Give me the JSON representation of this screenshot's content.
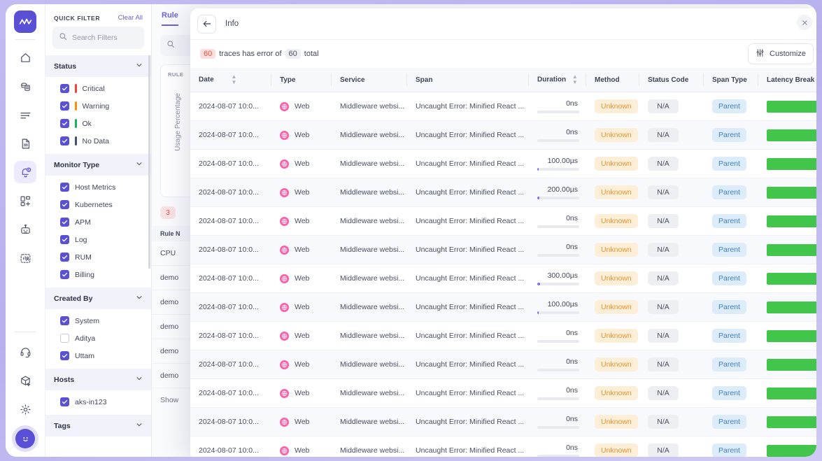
{
  "rail": {
    "logo_name": "middleware-logo",
    "items": [
      {
        "name": "home-icon"
      },
      {
        "name": "infrastructure-icon"
      },
      {
        "name": "logs-icon"
      },
      {
        "name": "documents-icon"
      },
      {
        "name": "alerts-icon",
        "active": true
      },
      {
        "name": "dashboards-add-icon"
      },
      {
        "name": "robot-icon"
      },
      {
        "name": "user-analytics-icon"
      }
    ],
    "bottom_items": [
      {
        "name": "support-headset-icon"
      },
      {
        "name": "package-add-icon"
      },
      {
        "name": "settings-gear-icon"
      }
    ],
    "avatar_name": "user-avatar"
  },
  "quick_filter": {
    "title": "QUICK FILTER",
    "clear_all": "Clear All",
    "search_placeholder": "Search Filters",
    "search_value": "",
    "groups": [
      {
        "label": "Status",
        "items": [
          {
            "label": "Critical",
            "checked": true,
            "color": "#f04438"
          },
          {
            "label": "Warning",
            "checked": true,
            "color": "#f79009"
          },
          {
            "label": "Ok",
            "checked": true,
            "color": "#17b26a"
          },
          {
            "label": "No Data",
            "checked": true,
            "color": "#475467"
          }
        ]
      },
      {
        "label": "Monitor Type",
        "items": [
          {
            "label": "Host Metrics",
            "checked": true
          },
          {
            "label": "Kubernetes",
            "checked": true
          },
          {
            "label": "APM",
            "checked": true
          },
          {
            "label": "Log",
            "checked": true
          },
          {
            "label": "RUM",
            "checked": true
          },
          {
            "label": "Billing",
            "checked": true
          }
        ]
      },
      {
        "label": "Created By",
        "items": [
          {
            "label": "System",
            "checked": true
          },
          {
            "label": "Aditya",
            "checked": false
          },
          {
            "label": "Uttam",
            "checked": true
          }
        ]
      },
      {
        "label": "Hosts",
        "items": [
          {
            "label": "aks-in123",
            "checked": true
          }
        ]
      },
      {
        "label": "Tags",
        "items": []
      }
    ]
  },
  "background": {
    "tab_label": "Rule",
    "card_label": "RULE",
    "vertical_axis_label": "Usage Percentage",
    "badge": "3",
    "table_header": "Rule N",
    "rows": [
      "CPU",
      "demo",
      "demo",
      "demo",
      "demo",
      "demo"
    ],
    "show_more": "Show"
  },
  "modal": {
    "title": "Info",
    "back_icon": "arrow-left-icon",
    "close_icon": "close-icon",
    "summary": {
      "error_count": "60",
      "text_middle": "traces has error of",
      "total_count": "60",
      "text_end": "total"
    },
    "customize_label": "Customize",
    "customize_icon": "sliders-icon",
    "table": {
      "columns": [
        {
          "key": "date",
          "label": "Date",
          "sortable": true
        },
        {
          "key": "type",
          "label": "Type",
          "sortable": false
        },
        {
          "key": "service",
          "label": "Service",
          "sortable": false
        },
        {
          "key": "span",
          "label": "Span",
          "sortable": false
        },
        {
          "key": "duration",
          "label": "Duration",
          "sortable": true
        },
        {
          "key": "method",
          "label": "Method",
          "sortable": false
        },
        {
          "key": "status_code",
          "label": "Status Code",
          "sortable": false
        },
        {
          "key": "span_type",
          "label": "Span Type",
          "sortable": false
        },
        {
          "key": "latency",
          "label": "Latency Break",
          "sortable": false
        }
      ],
      "rows": [
        {
          "date": "2024-08-07 10:0...",
          "type": "Web",
          "service": "Middleware websi...",
          "span": "Uncaught Error: Minified React ...",
          "duration": "0ns",
          "duration_pct": 0,
          "method": "Unknown",
          "status_code": "N/A",
          "span_type": "Parent",
          "latency_pct": 100
        },
        {
          "date": "2024-08-07 10:0...",
          "type": "Web",
          "service": "Middleware websi...",
          "span": "Uncaught Error: Minified React ...",
          "duration": "0ns",
          "duration_pct": 0,
          "method": "Unknown",
          "status_code": "N/A",
          "span_type": "Parent",
          "latency_pct": 100
        },
        {
          "date": "2024-08-07 10:0...",
          "type": "Web",
          "service": "Middleware websi...",
          "span": "Uncaught Error: Minified React ...",
          "duration": "100.00µs",
          "duration_pct": 4,
          "method": "Unknown",
          "status_code": "N/A",
          "span_type": "Parent",
          "latency_pct": 100
        },
        {
          "date": "2024-08-07 10:0...",
          "type": "Web",
          "service": "Middleware websi...",
          "span": "Uncaught Error: Minified React ...",
          "duration": "200.00µs",
          "duration_pct": 5,
          "method": "Unknown",
          "status_code": "N/A",
          "span_type": "Parent",
          "latency_pct": 100
        },
        {
          "date": "2024-08-07 10:0...",
          "type": "Web",
          "service": "Middleware websi...",
          "span": "Uncaught Error: Minified React ...",
          "duration": "0ns",
          "duration_pct": 0,
          "method": "Unknown",
          "status_code": "N/A",
          "span_type": "Parent",
          "latency_pct": 100
        },
        {
          "date": "2024-08-07 10:0...",
          "type": "Web",
          "service": "Middleware websi...",
          "span": "Uncaught Error: Minified React ...",
          "duration": "0ns",
          "duration_pct": 0,
          "method": "Unknown",
          "status_code": "N/A",
          "span_type": "Parent",
          "latency_pct": 100
        },
        {
          "date": "2024-08-07 10:0...",
          "type": "Web",
          "service": "Middleware websi...",
          "span": "Uncaught Error: Minified React ...",
          "duration": "300.00µs",
          "duration_pct": 6,
          "method": "Unknown",
          "status_code": "N/A",
          "span_type": "Parent",
          "latency_pct": 100
        },
        {
          "date": "2024-08-07 10:0...",
          "type": "Web",
          "service": "Middleware websi...",
          "span": "Uncaught Error: Minified React ...",
          "duration": "100.00µs",
          "duration_pct": 4,
          "method": "Unknown",
          "status_code": "N/A",
          "span_type": "Parent",
          "latency_pct": 100
        },
        {
          "date": "2024-08-07 10:0...",
          "type": "Web",
          "service": "Middleware websi...",
          "span": "Uncaught Error: Minified React ...",
          "duration": "0ns",
          "duration_pct": 0,
          "method": "Unknown",
          "status_code": "N/A",
          "span_type": "Parent",
          "latency_pct": 100
        },
        {
          "date": "2024-08-07 10:0...",
          "type": "Web",
          "service": "Middleware websi...",
          "span": "Uncaught Error: Minified React ...",
          "duration": "0ns",
          "duration_pct": 0,
          "method": "Unknown",
          "status_code": "N/A",
          "span_type": "Parent",
          "latency_pct": 100
        },
        {
          "date": "2024-08-07 10:0...",
          "type": "Web",
          "service": "Middleware websi...",
          "span": "Uncaught Error: Minified React ...",
          "duration": "0ns",
          "duration_pct": 0,
          "method": "Unknown",
          "status_code": "N/A",
          "span_type": "Parent",
          "latency_pct": 100
        },
        {
          "date": "2024-08-07 10:0...",
          "type": "Web",
          "service": "Middleware websi...",
          "span": "Uncaught Error: Minified React ...",
          "duration": "0ns",
          "duration_pct": 0,
          "method": "Unknown",
          "status_code": "N/A",
          "span_type": "Parent",
          "latency_pct": 100
        },
        {
          "date": "2024-08-07 10:0...",
          "type": "Web",
          "service": "Middleware websi...",
          "span": "Uncaught Error: Minified React ...",
          "duration": "0ns",
          "duration_pct": 0,
          "method": "Unknown",
          "status_code": "N/A",
          "span_type": "Parent",
          "latency_pct": 100
        }
      ]
    }
  },
  "colors": {
    "accent": "#5a50d6",
    "error": "#e8503e",
    "warning": "#e59434",
    "latency_green": "#41c64b",
    "web_pink": "#fb5fa8"
  }
}
